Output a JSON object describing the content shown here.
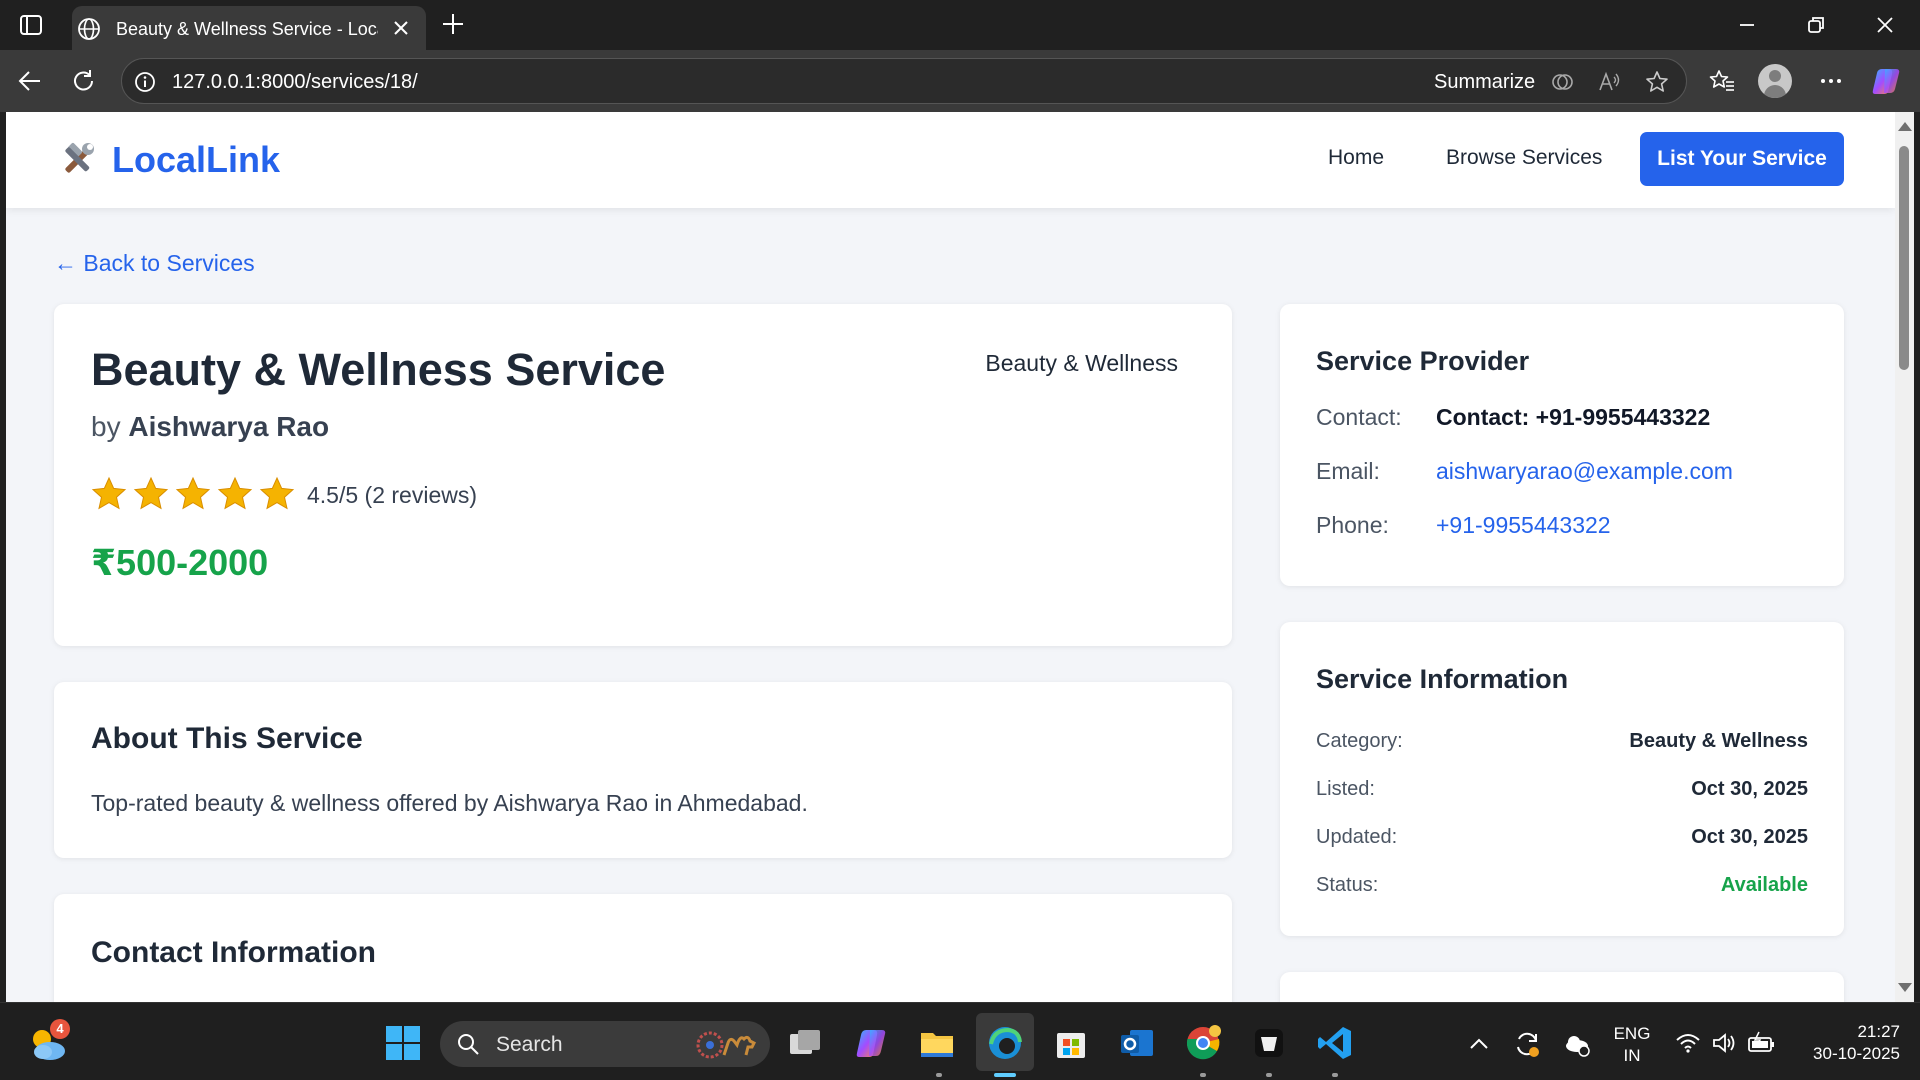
{
  "browser": {
    "tab_title": "Beauty & Wellness Service - LocalLink",
    "url": "127.0.0.1:8000/services/18/",
    "summarize_label": "Summarize"
  },
  "header": {
    "logo_text": "LocalLink",
    "nav": [
      "Home",
      "Browse Services"
    ],
    "cta_label": "List Your Service"
  },
  "page": {
    "back_link": "← Back to Services"
  },
  "service": {
    "title": "Beauty & Wellness Service",
    "category_badge": "Beauty & Wellness",
    "by_prefix": "by",
    "provider_name": "Aishwarya Rao",
    "stars_filled": 5,
    "rating_text": "4.5/5 (2 reviews)",
    "price": "₹500-2000"
  },
  "about": {
    "title": "About This Service",
    "description": "Top-rated beauty & wellness offered by Aishwarya Rao in Ahmedabad."
  },
  "contact_section": {
    "title": "Contact Information"
  },
  "provider_card": {
    "title": "Service Provider",
    "contact_label": "Contact:",
    "contact_value": "Contact: +91-9955443322",
    "email_label": "Email:",
    "email_value": "aishwaryarao@example.com",
    "phone_label": "Phone:",
    "phone_value": "+91-9955443322"
  },
  "info_card": {
    "title": "Service Information",
    "rows": [
      {
        "label": "Category:",
        "value": "Beauty & Wellness"
      },
      {
        "label": "Listed:",
        "value": "Oct 30, 2025"
      },
      {
        "label": "Updated:",
        "value": "Oct 30, 2025"
      },
      {
        "label": "Status:",
        "value": "Available"
      }
    ]
  },
  "taskbar": {
    "search_label": "Search",
    "weather_badge": "4",
    "lang_line1": "ENG",
    "lang_line2": "IN",
    "time": "21:27",
    "date": "30-10-2025"
  },
  "colors": {
    "brand": "#2563eb",
    "price": "#16a34a",
    "status_available": "#16a34a",
    "star": "#f5b301"
  }
}
